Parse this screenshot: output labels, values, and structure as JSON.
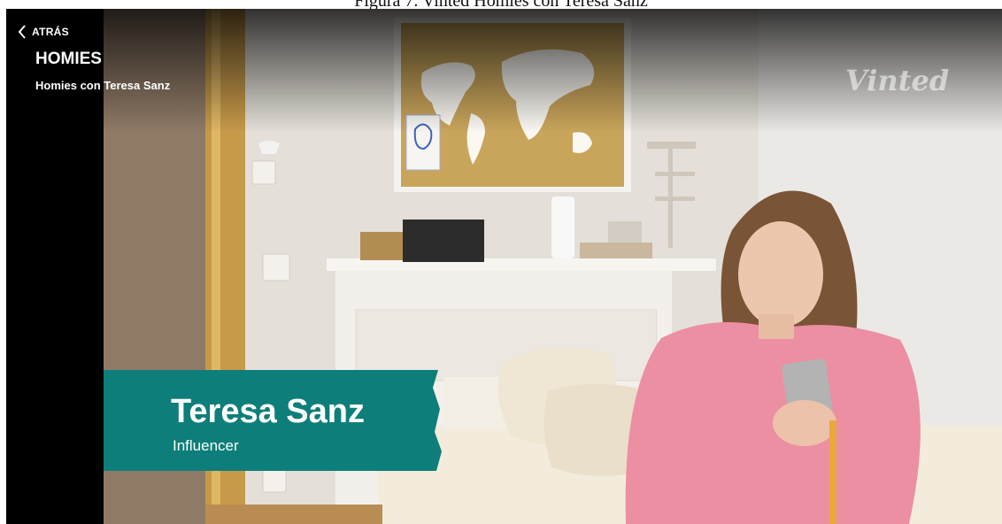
{
  "document": {
    "caption": "Figura 7. Vinted Homies con Teresa Sanz"
  },
  "player": {
    "back_label": "ATRÁS",
    "back_icon": "chevron-left-icon",
    "show_title": "HOMIES",
    "episode_title": "Homies con Teresa Sanz",
    "brand_watermark": "Vinted"
  },
  "lower_third": {
    "name": "Teresa Sanz",
    "role": "Influencer",
    "color": "#0e7e7a"
  }
}
